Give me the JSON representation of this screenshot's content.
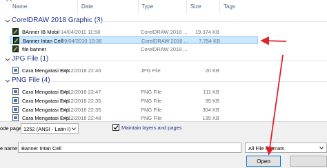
{
  "header": {
    "columns": [
      "Name",
      "Date",
      "Type",
      "Size",
      "Tags"
    ]
  },
  "groups": [
    {
      "title": "CorelDRAW 2018 Graphic (3)",
      "rows": [
        {
          "name": "BAnner IB Mobil",
          "date": "14/04/2011 11:58",
          "type": "CorelDRAW 2018 ...",
          "size": "19.374 KB",
          "icon": "coreldraw-file-icon"
        },
        {
          "name": "Banner Intan Cell",
          "date": "09/04/2010 10:36",
          "type": "CorelDRAW 2018 ...",
          "size": "7.754 KB",
          "icon": "coreldraw-file-icon",
          "selected": true
        },
        {
          "name": "file banner",
          "date": "",
          "type": "CorelDRAW 2018 ...",
          "size": "",
          "icon": "coreldraw-file-icon"
        }
      ]
    },
    {
      "title": "JPG File (1)",
      "rows": [
        {
          "name": "Cara Mengatasi Exp...",
          "date": "04/12/2018 22:46",
          "type": "JPG File",
          "size": "20 KB",
          "icon": "image-file-icon"
        }
      ]
    },
    {
      "title": "PNG File (4)",
      "rows": [
        {
          "name": "Cara Mengatasi Exp...",
          "date": "04/12/2018 22:47",
          "type": "PNG File",
          "size": "111 KB",
          "icon": "image-file-icon"
        },
        {
          "name": "Cara Mengatasi Exp...",
          "date": "04/12/2018 22:35",
          "type": "PNG File",
          "size": "95 KB",
          "icon": "image-file-icon"
        },
        {
          "name": "Cara Mengatasi Exp...",
          "date": "04/12/2018 22:35",
          "type": "PNG File",
          "size": "304 KB",
          "icon": "image-file-icon"
        },
        {
          "name": "Cara Mengatasi Exp...",
          "date": "04/12/2018 22:48",
          "type": "PNG File",
          "size": "135 KB",
          "icon": "image-file-icon"
        }
      ]
    }
  ],
  "options": {
    "code_page_label": "ode page",
    "code_page_value": "1252  (ANSI - Latin I)",
    "maintain_label": "Maintain layers and pages",
    "maintain_checked": true
  },
  "file": {
    "name_label": "e name:",
    "name_value": "Banner Intan Cell",
    "format_value": "All File Formats",
    "open_label": "Open"
  },
  "colors": {
    "annotation_arrow": "#e0202a",
    "group_title": "#1e3287",
    "selection": "#cce8ff"
  }
}
